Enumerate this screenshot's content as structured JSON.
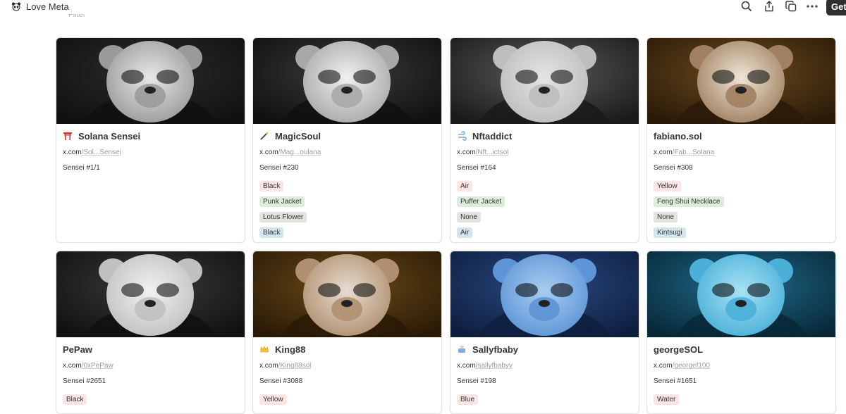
{
  "app": {
    "title": "Love Meta",
    "get_label": "Get",
    "filter_label": "Filter"
  },
  "toolbar_icons": [
    "search-icon",
    "share-icon",
    "duplicate-icon",
    "more-icon"
  ],
  "colors": {
    "tag_red": "#fbe4e4",
    "tag_green": "#dbeddb",
    "tag_gray": "#e3e2e0",
    "tag_blue": "#d3e5ef",
    "tag_yellow": "#fdecc8"
  },
  "cards": [
    {
      "name": "Solana Sensei",
      "icon": "torii-icon",
      "link_prefix": "x.com",
      "link_rest": "/Sol...Sensei",
      "number": "Sensei #1/1",
      "tags": []
    },
    {
      "name": "MagicSoul",
      "icon": "magic-wand-icon",
      "link_prefix": "x.com",
      "link_rest": "/Mag...oulana",
      "number": "Sensei #230",
      "tags": [
        {
          "text": "Black",
          "color": "red"
        },
        {
          "text": "Punk Jacket",
          "color": "green"
        },
        {
          "text": "Lotus Flower",
          "color": "gray"
        },
        {
          "text": "Black",
          "color": "blue"
        }
      ]
    },
    {
      "name": "Nftaddict",
      "icon": "wind-icon",
      "link_prefix": "x.com",
      "link_rest": "/Nft...ictsol",
      "number": "Sensei #164",
      "tags": [
        {
          "text": "Air",
          "color": "red"
        },
        {
          "text": "Puffer Jacket",
          "color": "green"
        },
        {
          "text": "None",
          "color": "gray"
        },
        {
          "text": "Air",
          "color": "blue"
        }
      ]
    },
    {
      "name": "fabiano.sol",
      "icon": "",
      "link_prefix": "x.com",
      "link_rest": "/Fab...Solana",
      "number": "Sensei #308",
      "tags": [
        {
          "text": "Yellow",
          "color": "red"
        },
        {
          "text": "Feng Shui Necklace",
          "color": "green"
        },
        {
          "text": "None",
          "color": "gray"
        },
        {
          "text": "Kintsugi",
          "color": "blue"
        }
      ]
    },
    {
      "name": "PePaw",
      "icon": "",
      "link_prefix": "x.com",
      "link_rest": "/0xPePaw",
      "number": "Sensei #2651",
      "tags": [
        {
          "text": "Black",
          "color": "red"
        }
      ]
    },
    {
      "name": "King88",
      "icon": "crown-icon",
      "link_prefix": "x.com",
      "link_rest": "/King88sol",
      "number": "Sensei #3088",
      "tags": [
        {
          "text": "Yellow",
          "color": "red"
        }
      ]
    },
    {
      "name": "Sallyfbaby",
      "icon": "baby-icon",
      "link_prefix": "x.com",
      "link_rest": "/sallyfbabyy",
      "number": "Sensei #198",
      "tags": [
        {
          "text": "Blue",
          "color": "red"
        }
      ]
    },
    {
      "name": "georgeSOL",
      "icon": "",
      "link_prefix": "x.com",
      "link_rest": "/georgef100",
      "number": "Sensei #1651",
      "tags": [
        {
          "text": "Water",
          "color": "red"
        }
      ]
    }
  ]
}
